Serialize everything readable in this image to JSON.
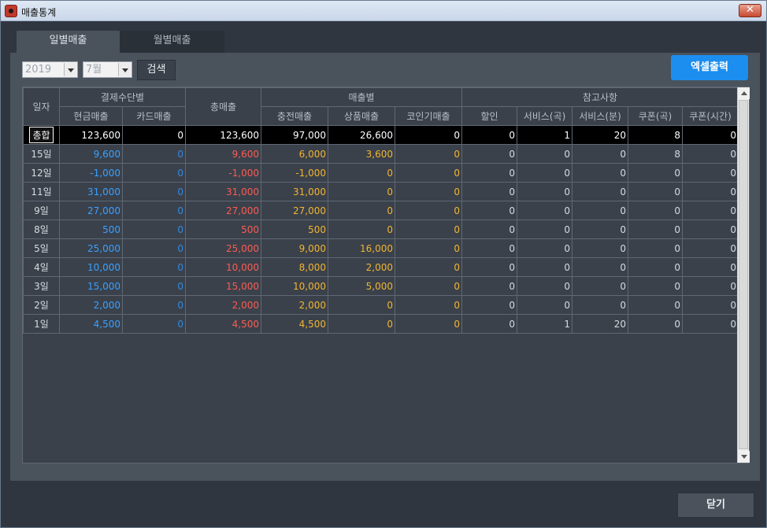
{
  "window": {
    "title": "매출통계",
    "close_glyph": "✕"
  },
  "tabs": [
    {
      "label": "일별매출"
    },
    {
      "label": "월별매출"
    }
  ],
  "filters": {
    "year": {
      "value": "2019"
    },
    "month": {
      "value": "7월"
    },
    "search_label": "검색",
    "excel_label": "엑셀출력"
  },
  "table": {
    "groups": {
      "date": "일자",
      "payment": "결제수단별",
      "total_sales": "총매출",
      "by_sales": "매출별",
      "reference": "참고사항"
    },
    "columns": {
      "cash": "현금매출",
      "card": "카드매출",
      "charge": "충전매출",
      "product": "상품매출",
      "coin": "코인기매출",
      "discount": "할인",
      "service_song": "서비스(곡)",
      "service_min": "서비스(분)",
      "coupon_song": "쿠폰(곡)",
      "coupon_time": "쿠폰(시간)"
    },
    "rows": [
      [
        "총합",
        "123,600",
        "0",
        "123,600",
        "97,000",
        "26,600",
        "0",
        "0",
        "1",
        "20",
        "8",
        "0"
      ],
      [
        "15일",
        "9,600",
        "0",
        "9,600",
        "6,000",
        "3,600",
        "0",
        "0",
        "0",
        "0",
        "8",
        "0"
      ],
      [
        "12일",
        "-1,000",
        "0",
        "-1,000",
        "-1,000",
        "0",
        "0",
        "0",
        "0",
        "0",
        "0",
        "0"
      ],
      [
        "11일",
        "31,000",
        "0",
        "31,000",
        "31,000",
        "0",
        "0",
        "0",
        "0",
        "0",
        "0",
        "0"
      ],
      [
        "9일",
        "27,000",
        "0",
        "27,000",
        "27,000",
        "0",
        "0",
        "0",
        "0",
        "0",
        "0",
        "0"
      ],
      [
        "8일",
        "500",
        "0",
        "500",
        "500",
        "0",
        "0",
        "0",
        "0",
        "0",
        "0",
        "0"
      ],
      [
        "5일",
        "25,000",
        "0",
        "25,000",
        "9,000",
        "16,000",
        "0",
        "0",
        "0",
        "0",
        "0",
        "0"
      ],
      [
        "4일",
        "10,000",
        "0",
        "10,000",
        "8,000",
        "2,000",
        "0",
        "0",
        "0",
        "0",
        "0",
        "0"
      ],
      [
        "3일",
        "15,000",
        "0",
        "15,000",
        "10,000",
        "5,000",
        "0",
        "0",
        "0",
        "0",
        "0",
        "0"
      ],
      [
        "2일",
        "2,000",
        "0",
        "2,000",
        "2,000",
        "0",
        "0",
        "0",
        "0",
        "0",
        "0",
        "0"
      ],
      [
        "1일",
        "4,500",
        "0",
        "4,500",
        "4,500",
        "0",
        "0",
        "0",
        "1",
        "20",
        "0",
        "0"
      ]
    ]
  },
  "footer": {
    "close_label": "닫기"
  },
  "colors": {
    "cash": "#3aa0ff",
    "card": "#2f8be6",
    "total": "#ff5b52",
    "sale": "#f2b431",
    "excel_button": "#1b8ef0",
    "background": "#2f3640"
  }
}
